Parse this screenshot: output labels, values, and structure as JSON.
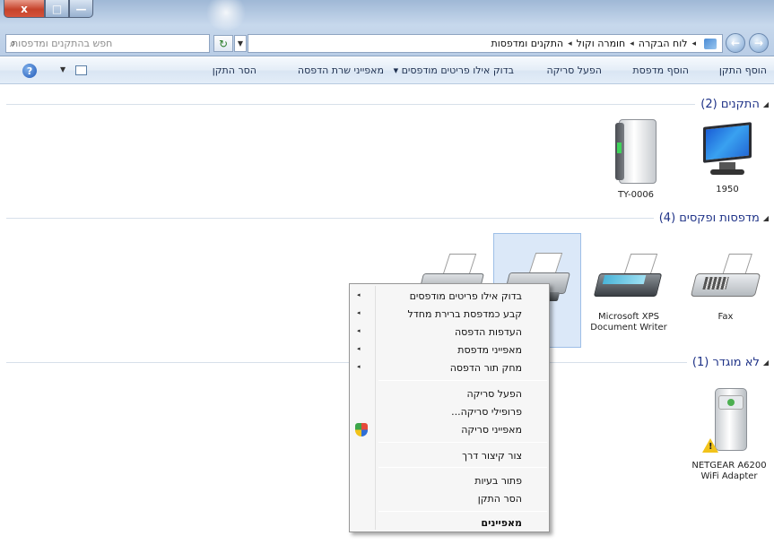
{
  "window": {
    "close_glyph": "x",
    "max_glyph": "□",
    "min_glyph": "—"
  },
  "address": {
    "breadcrumb": [
      "לוח הבקרה",
      "חומרה וקול",
      "התקנים ומדפסות"
    ],
    "search_placeholder": "חפש בהתקנים ומדפסות"
  },
  "commandbar": {
    "add_device": "הוסף התקן",
    "add_printer": "הוסף מדפסת",
    "start_scan": "הפעל סריקה",
    "see_printing": "בדוק אילו פריטים מודפסים ▾",
    "print_server_props": "מאפייני שרת הדפסה",
    "remove_device": "הסר התקן"
  },
  "groups": {
    "devices": {
      "title": "התקנים (2)"
    },
    "printers": {
      "title": "מדפסות ופקסים (4)"
    },
    "unspecified": {
      "title": "לא מוגדר (1)"
    }
  },
  "devices": {
    "monitor": "1950",
    "drive": "TY-0006",
    "fax": "Fax",
    "xps": "Microsoft XPS Document Writer",
    "router": "NETGEAR A6200 WiFi Adapter"
  },
  "context_menu": {
    "items": [
      "בדוק אילו פריטים מודפסים",
      "קבע כמדפסת ברירת מחדל",
      "העדפות הדפסה",
      "מאפייני מדפסת",
      "מחק תור הדפסה",
      "הפעל סריקה",
      "פרופילי סריקה...",
      "מאפייני סריקה",
      "צור קיצור דרך",
      "פתור בעיות",
      "הסר התקן",
      "מאפיינים"
    ],
    "submenu_glyph": "◂"
  },
  "icons": {
    "search": "search-icon",
    "help": "help-icon",
    "shield": "shield-icon",
    "refresh": "refresh-icon"
  }
}
